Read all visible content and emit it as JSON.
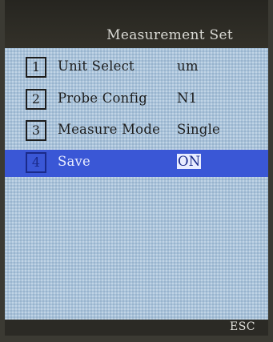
{
  "header": {
    "title": "Measurement Set"
  },
  "menu": {
    "items": [
      {
        "number": "1",
        "label": "Unit Select",
        "value": "um",
        "selected": false
      },
      {
        "number": "2",
        "label": "Probe Config",
        "value": "N1",
        "selected": false
      },
      {
        "number": "3",
        "label": "Measure Mode",
        "value": "Single",
        "selected": false
      },
      {
        "number": "4",
        "label": "Save",
        "value": "ON",
        "selected": true
      }
    ]
  },
  "footer": {
    "esc_label": "ESC"
  },
  "colors": {
    "screen_background": "#a9c3da",
    "selection_highlight": "#3a57d6",
    "title_bar": "#2a2924",
    "text": "#1e1e1e"
  }
}
